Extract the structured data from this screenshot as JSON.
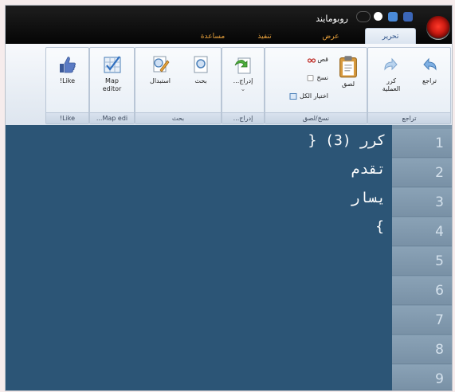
{
  "window": {
    "title": "روبومايند"
  },
  "tabs": [
    {
      "label": "تحرير",
      "active": true
    },
    {
      "label": "عرض",
      "active": false
    },
    {
      "label": "تنفيذ",
      "active": false
    },
    {
      "label": "مساعدة",
      "active": false
    }
  ],
  "ribbon": {
    "undo_group": {
      "label": "تراجع",
      "undo": "تراجع",
      "redo_line1": "كرر",
      "redo_line2": "العملية"
    },
    "clipboard_group": {
      "label": "نسخ/لصق",
      "paste": "لصق",
      "cut": "قص",
      "copy": "نسخ",
      "select_all": "اختيار الكل"
    },
    "insert_group": {
      "label": "إدراج...",
      "insert": "إدراج...",
      "arrow": "⌄"
    },
    "search_group": {
      "label": "بحث",
      "search": "بحث",
      "replace": "استبدال"
    },
    "map_group": {
      "label": "Map edi...",
      "map_editor_line1": "Map",
      "map_editor_line2": "editor"
    },
    "like_group": {
      "label": "Like!",
      "like": "Like!"
    }
  },
  "editor": {
    "lines": [
      {
        "number": "1",
        "text": "كرر (3) {"
      },
      {
        "number": "2",
        "text": "تقدم"
      },
      {
        "number": "3",
        "text": "يسار"
      },
      {
        "number": "4",
        "text": "}"
      },
      {
        "number": "5",
        "text": ""
      },
      {
        "number": "6",
        "text": ""
      },
      {
        "number": "7",
        "text": ""
      },
      {
        "number": "8",
        "text": ""
      },
      {
        "number": "9",
        "text": ""
      }
    ]
  },
  "colors": {
    "editor_bg": "#2c5576",
    "gutter_bg": "#7f98ad",
    "titlebar_bg": "#0b0b0b",
    "accent_tab": "#e8a13c"
  }
}
